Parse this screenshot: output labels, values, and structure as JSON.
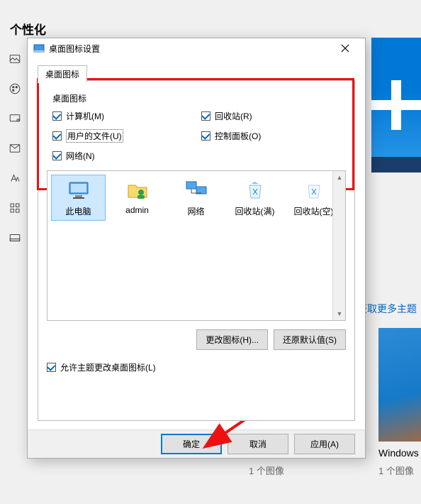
{
  "bg": {
    "title": "个性化",
    "moreThemesLink": "获取更多主题",
    "thumbLabel": "Windows",
    "imageCount": "1 个图像",
    "imageCountMid": "1 个图像"
  },
  "dialog": {
    "title": "桌面图标设置",
    "tab": "桌面图标",
    "groupLabel": "桌面图标",
    "checks": {
      "computer": "计算机(M)",
      "recycle": "回收站(R)",
      "userFiles": "用户的文件(U)",
      "controlPanel": "控制面板(O)",
      "network": "网络(N)"
    },
    "icons": [
      "此电脑",
      "admin",
      "网络",
      "回收站(满)",
      "回收站(空)"
    ],
    "changeIcon": "更改图标(H)...",
    "restoreDefault": "还原默认值(S)",
    "allowThemes": "允许主题更改桌面图标(L)",
    "ok": "确定",
    "cancel": "取消",
    "apply": "应用(A)"
  }
}
